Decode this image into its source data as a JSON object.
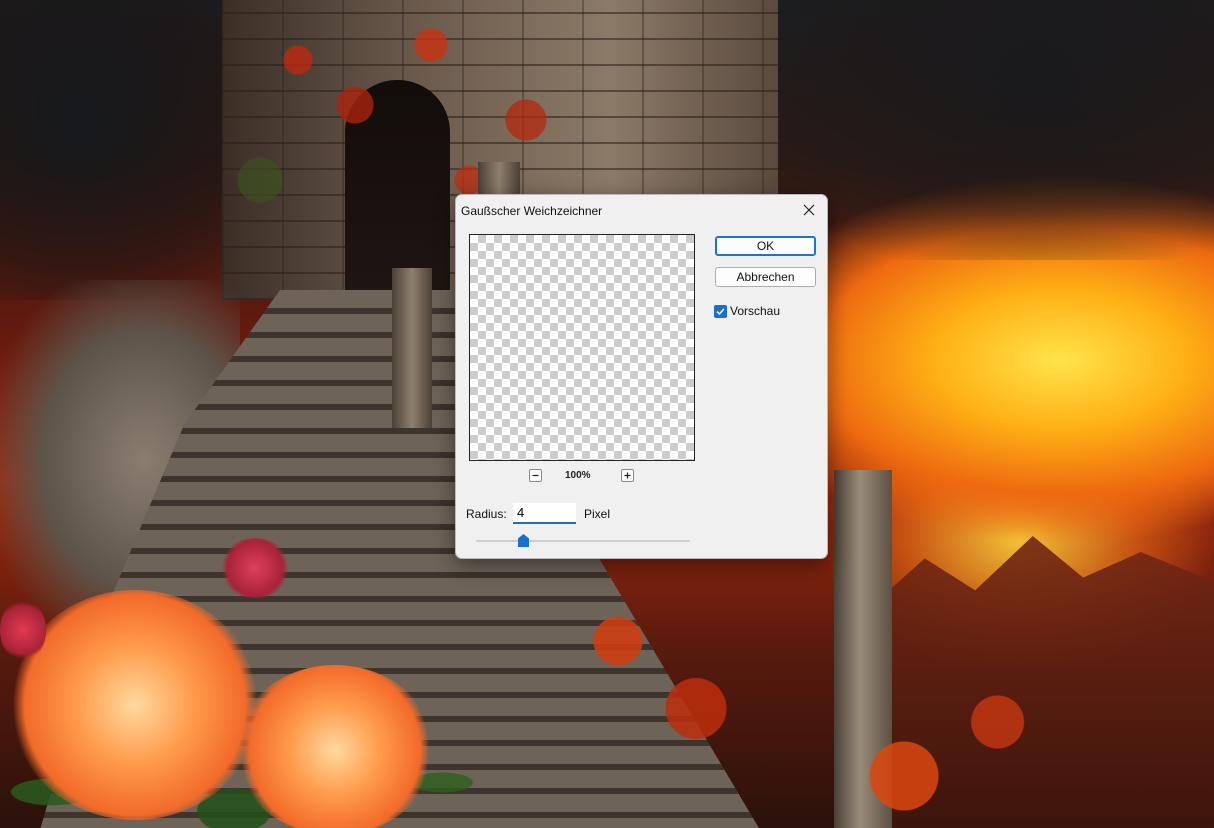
{
  "dialog": {
    "title": "Gaußscher Weichzeichner",
    "ok_label": "OK",
    "cancel_label": "Abbrechen",
    "preview_label": "Vorschau",
    "preview_checked": true,
    "zoom": {
      "level": "100%",
      "zoom_out_symbol": "–",
      "zoom_in_symbol": "+"
    },
    "radius": {
      "label": "Radius:",
      "value": "4",
      "unit": "Pixel",
      "slider_fraction": 0.22
    }
  },
  "icons": {
    "close": "close-icon",
    "check": "checkmark-icon"
  },
  "colors": {
    "accent": "#1a6ecf",
    "dialog_bg": "#f0f0f0"
  }
}
